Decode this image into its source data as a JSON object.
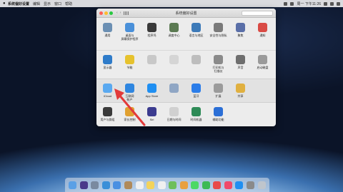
{
  "menubar": {
    "app_name": "系统偏好设置",
    "items": [
      "编辑",
      "显示",
      "窗口",
      "帮助"
    ],
    "clock": "周一 下午11:26"
  },
  "window": {
    "title": "系统偏好设置",
    "search_placeholder": ""
  },
  "panes": {
    "row1": [
      {
        "label": "通用",
        "icon": "general-icon",
        "color": "#6b8fb3"
      },
      {
        "label": "桌面与\n屏幕保护程序",
        "icon": "desktop-icon",
        "color": "#4a90d9"
      },
      {
        "label": "程序坞",
        "icon": "dock-icon",
        "color": "#3a3a3a"
      },
      {
        "label": "调度中心",
        "icon": "mission-control-icon",
        "color": "#5b7a52"
      },
      {
        "label": "语言与地区",
        "icon": "language-icon",
        "color": "#3d7ab8"
      },
      {
        "label": "安全性与隐私",
        "icon": "security-icon",
        "color": "#7a7a7a"
      },
      {
        "label": "聚焦",
        "icon": "spotlight-icon",
        "color": "#5a6fa8"
      },
      {
        "label": "通知",
        "icon": "notifications-icon",
        "color": "#d94b45"
      }
    ],
    "row2": [
      {
        "label": "显示器",
        "icon": "displays-icon",
        "color": "#2e7bc9"
      },
      {
        "label": "节能",
        "icon": "energy-icon",
        "color": "#e6c22e"
      },
      {
        "label": "",
        "icon": "keyboard-icon",
        "color": "#c8c8c8"
      },
      {
        "label": "",
        "icon": "mouse-icon",
        "color": "#d5d5d5"
      },
      {
        "label": "",
        "icon": "trackpad-icon",
        "color": "#bdbdbd"
      },
      {
        "label": "打印机与\n扫描仪",
        "icon": "printer-icon",
        "color": "#8a8a8a"
      },
      {
        "label": "声音",
        "icon": "sound-icon",
        "color": "#6e6e6e"
      },
      {
        "label": "启动磁盘",
        "icon": "startup-disk-icon",
        "color": "#9a9a9a"
      }
    ],
    "row3": [
      {
        "label": "iCloud",
        "icon": "icloud-icon",
        "color": "#5aa9f0"
      },
      {
        "label": "互联网\n帐户",
        "icon": "internet-accounts-icon",
        "color": "#2f86e0"
      },
      {
        "label": "App Store",
        "icon": "app-store-icon",
        "color": "#1f8ff2"
      },
      {
        "label": "",
        "icon": "network-icon",
        "color": "#8fa6c4"
      },
      {
        "label": "蓝牙",
        "icon": "bluetooth-icon",
        "color": "#2b7de9"
      },
      {
        "label": "扩展",
        "icon": "extensions-icon",
        "color": "#9b9b9b"
      },
      {
        "label": "共享",
        "icon": "sharing-icon",
        "color": "#e0b040"
      }
    ],
    "row4": [
      {
        "label": "用户与群组",
        "icon": "users-groups-icon",
        "color": "#3a3a3a"
      },
      {
        "label": "家长控制",
        "icon": "parental-controls-icon",
        "color": "#e0a030"
      },
      {
        "label": "Siri",
        "icon": "siri-icon",
        "color": "#3b3b8f"
      },
      {
        "label": "日期与时间",
        "icon": "date-time-icon",
        "color": "#d0d0d0"
      },
      {
        "label": "时间机器",
        "icon": "time-machine-icon",
        "color": "#2e8b57"
      },
      {
        "label": "辅助功能",
        "icon": "accessibility-icon",
        "color": "#2b6fd6"
      }
    ]
  },
  "dock": {
    "icons": [
      {
        "name": "finder-icon",
        "color": "#5aa0e6"
      },
      {
        "name": "siri-dock-icon",
        "color": "#4a3a8a"
      },
      {
        "name": "launchpad-icon",
        "color": "#7a8aa0"
      },
      {
        "name": "safari-icon",
        "color": "#3a8fd8"
      },
      {
        "name": "mail-icon",
        "color": "#4a90e2"
      },
      {
        "name": "contacts-icon",
        "color": "#b08a5a"
      },
      {
        "name": "calendar-icon",
        "color": "#f0f0f0"
      },
      {
        "name": "notes-icon",
        "color": "#f3d35a"
      },
      {
        "name": "reminders-icon",
        "color": "#f0f0f0"
      },
      {
        "name": "maps-icon",
        "color": "#6fbf5a"
      },
      {
        "name": "photos-icon",
        "color": "#e8a040"
      },
      {
        "name": "messages-icon",
        "color": "#4cd964"
      },
      {
        "name": "facetime-icon",
        "color": "#3cba54"
      },
      {
        "name": "news-icon",
        "color": "#e84a4a"
      },
      {
        "name": "music-icon",
        "color": "#f04a6a"
      },
      {
        "name": "app-store-dock-icon",
        "color": "#1f8ff2"
      },
      {
        "name": "system-preferences-dock-icon",
        "color": "#8a8a8a"
      },
      {
        "name": "trash-icon",
        "color": "#bfc5cc"
      }
    ]
  },
  "annotation": {
    "arrow_color": "#e23a3a"
  }
}
